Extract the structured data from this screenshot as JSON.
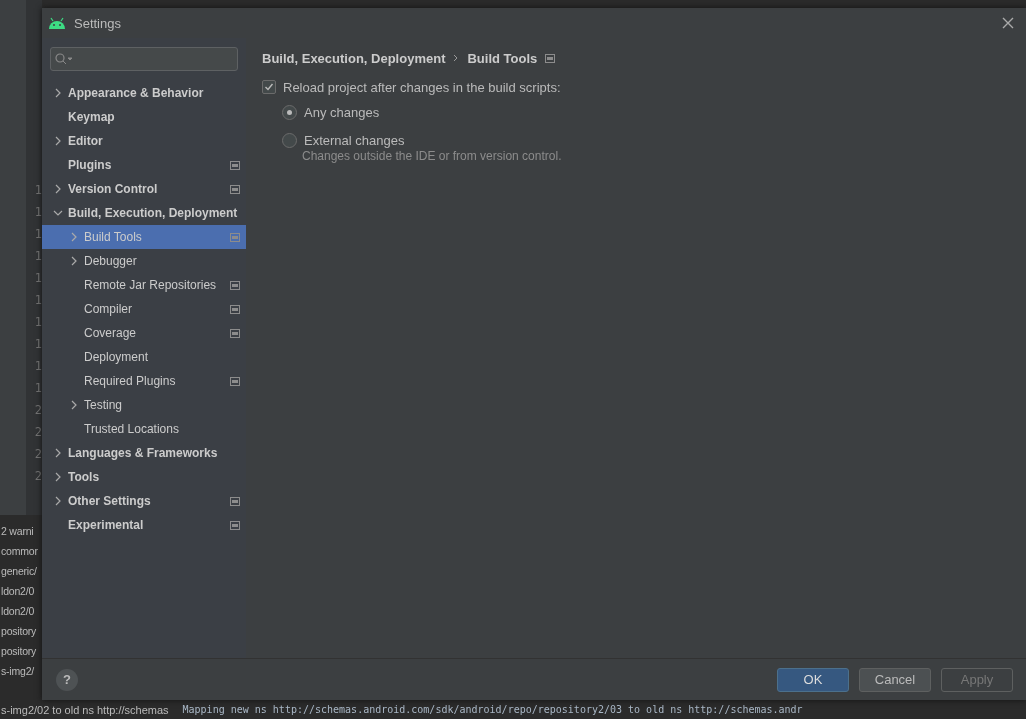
{
  "background": {
    "gutter_numbers": [
      "1",
      "1",
      "1",
      "1",
      "1",
      "1",
      "1",
      "1",
      "1",
      "1",
      "2",
      "2",
      "2",
      "2"
    ],
    "log_lines": [
      "2 warni",
      "commor",
      "generic/",
      "ldon2/0",
      "ldon2/0",
      "pository",
      "pository",
      "s-img2/"
    ],
    "last_log": "s-img2/02 to old ns http://schemas",
    "bottom_log": "Mapping new ns http://schemas.android.com/sdk/android/repo/repository2/03 to old ns http://schemas.andr"
  },
  "window": {
    "title": "Settings"
  },
  "sidebar": {
    "items": [
      {
        "label": "Appearance & Behavior",
        "kind": "collapsed",
        "selected": false,
        "project_scoped": false
      },
      {
        "label": "Keymap",
        "kind": "leaf",
        "selected": false,
        "project_scoped": false
      },
      {
        "label": "Editor",
        "kind": "collapsed",
        "selected": false,
        "project_scoped": false
      },
      {
        "label": "Plugins",
        "kind": "leaf",
        "selected": false,
        "project_scoped": true
      },
      {
        "label": "Version Control",
        "kind": "collapsed",
        "selected": false,
        "project_scoped": true
      },
      {
        "label": "Build, Execution, Deployment",
        "kind": "expanded",
        "selected": false,
        "project_scoped": false,
        "children": [
          {
            "label": "Build Tools",
            "kind": "collapsed",
            "selected": true,
            "project_scoped": true
          },
          {
            "label": "Debugger",
            "kind": "collapsed",
            "selected": false,
            "project_scoped": false
          },
          {
            "label": "Remote Jar Repositories",
            "kind": "leaf",
            "selected": false,
            "project_scoped": true
          },
          {
            "label": "Compiler",
            "kind": "leaf",
            "selected": false,
            "project_scoped": true
          },
          {
            "label": "Coverage",
            "kind": "leaf",
            "selected": false,
            "project_scoped": true
          },
          {
            "label": "Deployment",
            "kind": "leaf",
            "selected": false,
            "project_scoped": false
          },
          {
            "label": "Required Plugins",
            "kind": "leaf",
            "selected": false,
            "project_scoped": true
          },
          {
            "label": "Testing",
            "kind": "collapsed",
            "selected": false,
            "project_scoped": false
          },
          {
            "label": "Trusted Locations",
            "kind": "leaf",
            "selected": false,
            "project_scoped": false
          }
        ]
      },
      {
        "label": "Languages & Frameworks",
        "kind": "collapsed",
        "selected": false,
        "project_scoped": false
      },
      {
        "label": "Tools",
        "kind": "collapsed",
        "selected": false,
        "project_scoped": false
      },
      {
        "label": "Other Settings",
        "kind": "collapsed",
        "selected": false,
        "project_scoped": true
      },
      {
        "label": "Experimental",
        "kind": "leaf",
        "selected": false,
        "project_scoped": true
      }
    ]
  },
  "content": {
    "breadcrumb": [
      "Build, Execution, Deployment",
      "Build Tools"
    ],
    "project_scoped": true,
    "reload": {
      "label": "Reload project after changes in the build scripts:",
      "checked": true
    },
    "options": [
      {
        "label": "Any changes",
        "selected": true
      },
      {
        "label": "External changes",
        "selected": false
      }
    ],
    "hint": "Changes outside the IDE or from version control."
  },
  "footer": {
    "help": "?",
    "buttons": [
      {
        "label": "OK",
        "kind": "primary",
        "disabled": false
      },
      {
        "label": "Cancel",
        "kind": "normal",
        "disabled": false
      },
      {
        "label": "Apply",
        "kind": "normal",
        "disabled": true
      }
    ]
  }
}
